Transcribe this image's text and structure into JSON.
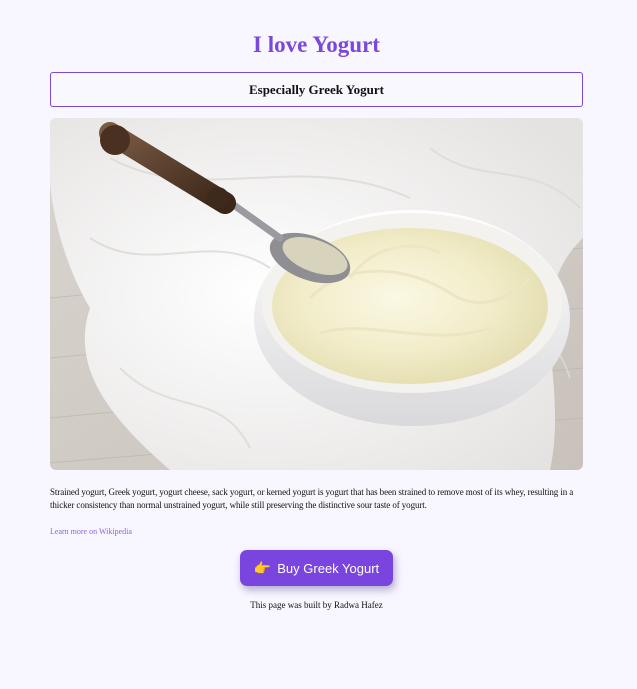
{
  "page": {
    "title": "I love Yogurt",
    "subtitle": "Especially Greek Yogurt"
  },
  "image": {
    "alt": "A white bowl of creamy Greek yogurt with a spoon"
  },
  "description": "Strained yogurt, Greek yogurt, yogurt cheese, sack yogurt, or kerned yogurt is yogurt that has been strained to remove most of its whey, resulting in a thicker consistency than normal unstrained yogurt, while still preserving the distinctive sour taste of yogurt.",
  "wiki_link": {
    "label": "Learn more on Wikipedia"
  },
  "buy_button": {
    "label": "Buy Greek Yogurt",
    "icon": "pointing-hand-icon"
  },
  "footer": {
    "text": "This page was built by Radwa Hafez"
  },
  "colors": {
    "accent": "#7b48dc",
    "background": "#f8f6ff"
  }
}
